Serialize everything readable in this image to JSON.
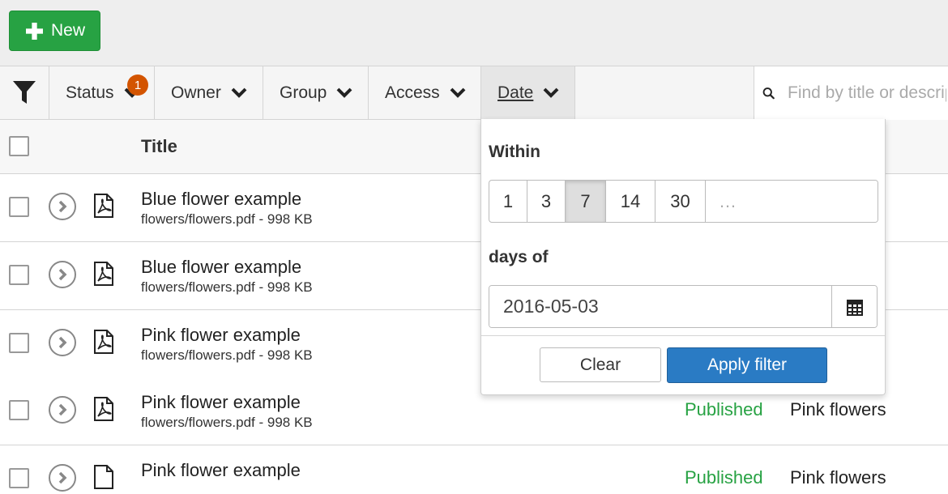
{
  "toolbar": {
    "new_label": "New"
  },
  "filters": {
    "status": {
      "label": "Status",
      "badge": "1"
    },
    "owner": {
      "label": "Owner"
    },
    "group": {
      "label": "Group"
    },
    "access": {
      "label": "Access"
    },
    "date": {
      "label": "Date"
    }
  },
  "search": {
    "placeholder": "Find by title or description"
  },
  "table": {
    "header_title": "Title",
    "rows": [
      {
        "title": "Blue flower example",
        "subtitle": "flowers/flowers.pdf - 998 KB",
        "status": "",
        "tag": ""
      },
      {
        "title": "Blue flower example",
        "subtitle": "flowers/flowers.pdf - 998 KB",
        "status": "",
        "tag": ""
      },
      {
        "title": "Pink flower example",
        "subtitle": "flowers/flowers.pdf - 998 KB",
        "status": "",
        "tag": ""
      },
      {
        "title": "Pink flower example",
        "subtitle": "flowers/flowers.pdf - 998 KB",
        "status": "Published",
        "tag": "Pink flowers"
      },
      {
        "title": "Pink flower example",
        "subtitle": "",
        "status": "Published",
        "tag": "Pink flowers"
      }
    ]
  },
  "date_filter": {
    "within_label": "Within",
    "day_options": [
      "1",
      "3",
      "7",
      "14",
      "30"
    ],
    "selected": "7",
    "custom_placeholder": "…",
    "days_of_label": "days of",
    "date_value": "2016-05-03",
    "clear_label": "Clear",
    "apply_label": "Apply filter"
  },
  "colors": {
    "new": "#27a243",
    "apply": "#2a7bc4",
    "badge": "#d35400",
    "published": "#27a243"
  },
  "icons": {
    "new": "plus-icon",
    "filter": "funnel-icon",
    "search": "search-icon",
    "calendar": "calendar-icon",
    "file": "pdf-file-icon",
    "expand": "chevron-right-circle-icon"
  }
}
